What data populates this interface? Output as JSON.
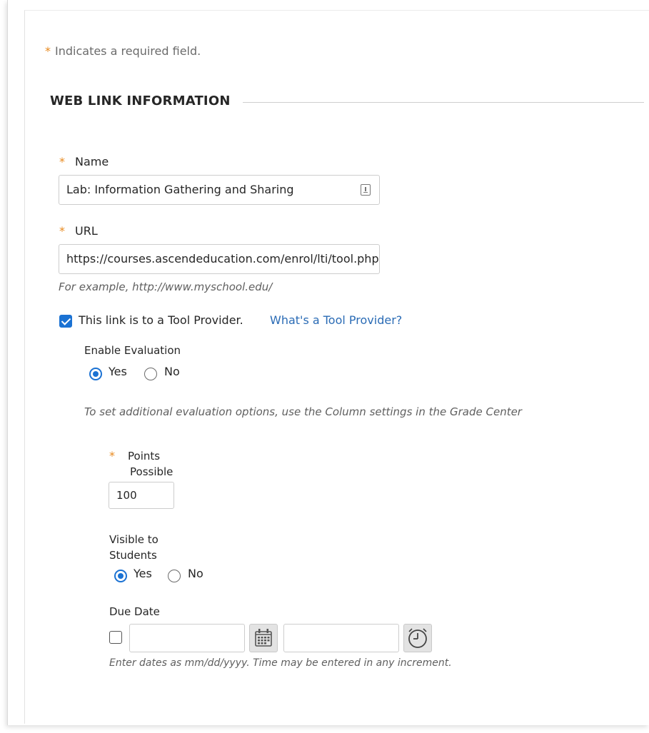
{
  "form": {
    "required_note": "Indicates a required field.",
    "section_title": "WEB LINK INFORMATION",
    "name": {
      "label": "Name",
      "value": "Lab: Information Gathering and Sharing"
    },
    "url": {
      "label": "URL",
      "value": "https://courses.ascendeducation.com/enrol/lti/tool.php?id=",
      "example": "For example, http://www.myschool.edu/"
    },
    "tool_provider": {
      "checked": true,
      "label": "This link is to a Tool Provider.",
      "help_link": "What's a Tool Provider?"
    },
    "enable_evaluation": {
      "label": "Enable Evaluation",
      "yes": "Yes",
      "no": "No",
      "selected": "Yes",
      "note": "To set additional evaluation options, use the Column settings in the Grade Center"
    },
    "points_possible": {
      "label_line1": "Points",
      "label_line2": "Possible",
      "value": "100"
    },
    "visible_to_students": {
      "label_line1": "Visible to",
      "label_line2": "Students",
      "yes": "Yes",
      "no": "No",
      "selected": "Yes"
    },
    "due_date": {
      "label": "Due Date",
      "checked": false,
      "date_value": "",
      "time_value": "",
      "hint": "Enter dates as mm/dd/yyyy. Time may be entered in any increment."
    }
  },
  "colors": {
    "accent": "#1b72d3",
    "required_star": "#e8891e",
    "link": "#2a6bb5"
  },
  "icons": {
    "spellcheck": "spellcheck-icon",
    "calendar": "calendar-icon",
    "clock": "clock-icon"
  }
}
